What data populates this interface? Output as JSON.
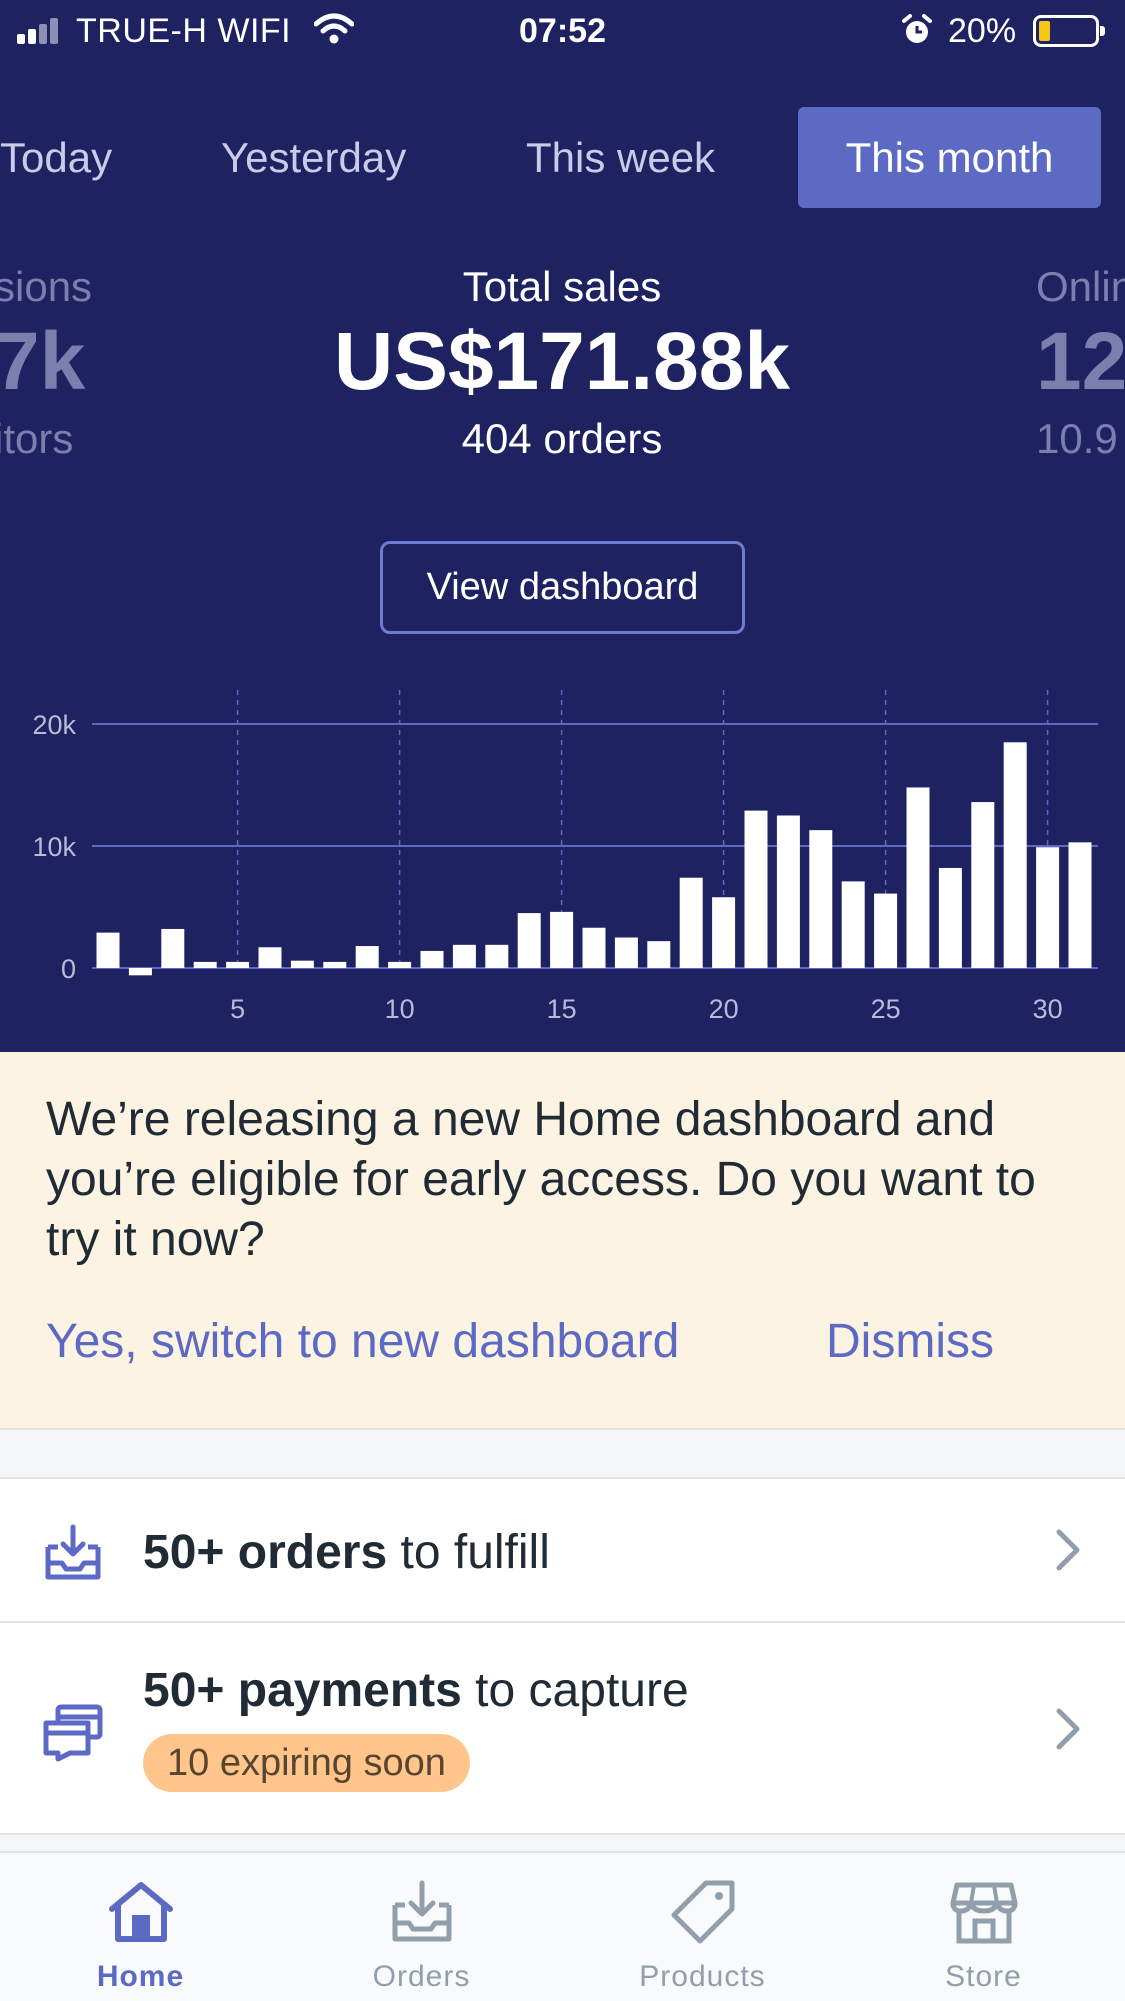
{
  "status_bar": {
    "carrier": "TRUE-H WIFI",
    "time": "07:52",
    "battery": "20%"
  },
  "period_tabs": [
    "Today",
    "Yesterday",
    "This week",
    "This month"
  ],
  "active_period": "This month",
  "metrics": {
    "left": {
      "label": "sions",
      "value": "7k",
      "sub": "itors"
    },
    "center": {
      "label": "Total sales",
      "value": "US$171.88k",
      "sub": "404 orders"
    },
    "right": {
      "label": "Onlin",
      "value": "12",
      "sub": "10.9"
    }
  },
  "view_dashboard_label": "View dashboard",
  "chart_data": {
    "type": "bar",
    "x": [
      1,
      2,
      3,
      4,
      5,
      6,
      7,
      8,
      9,
      10,
      11,
      12,
      13,
      14,
      15,
      16,
      17,
      18,
      19,
      20,
      21,
      22,
      23,
      24,
      25,
      26,
      27,
      28,
      29,
      30,
      31
    ],
    "values": [
      2900,
      -600,
      3200,
      500,
      500,
      1700,
      600,
      500,
      1800,
      500,
      1400,
      1900,
      1900,
      4500,
      4600,
      3300,
      2500,
      2200,
      7400,
      5800,
      12900,
      12500,
      11300,
      7100,
      6100,
      14800,
      8200,
      13600,
      18500,
      9900,
      10300
    ],
    "xticks": [
      "5",
      "10",
      "15",
      "20",
      "25",
      "30"
    ],
    "yticks": [
      "0",
      "10k",
      "20k"
    ],
    "ylim": [
      -1000,
      24000
    ],
    "grid": true,
    "colors": {
      "bar": "#ffffff",
      "grid": "#5c6ac4"
    }
  },
  "notice": {
    "text": "We’re releasing a new Home dashboard and you’re eligible for early access. Do you want to try it now?",
    "primary_action": "Yes, switch to new dashboard",
    "dismiss": "Dismiss"
  },
  "tasks": [
    {
      "bold": "50+ orders",
      "rest": " to fulfill",
      "icon": "inbox-download-icon"
    },
    {
      "bold": "50+ payments",
      "rest": " to capture",
      "badge": "10 expiring soon",
      "icon": "payments-icon"
    }
  ],
  "bottom_nav": [
    {
      "label": "Home",
      "icon": "home-icon",
      "active": true
    },
    {
      "label": "Orders",
      "icon": "orders-icon",
      "active": false
    },
    {
      "label": "Products",
      "icon": "tag-icon",
      "active": false
    },
    {
      "label": "Store",
      "icon": "store-icon",
      "active": false
    }
  ],
  "colors": {
    "header_bg": "#1f2260",
    "accent": "#5c6ac4",
    "notice_bg": "#fcf3e3",
    "badge_bg": "#ffc58b"
  }
}
